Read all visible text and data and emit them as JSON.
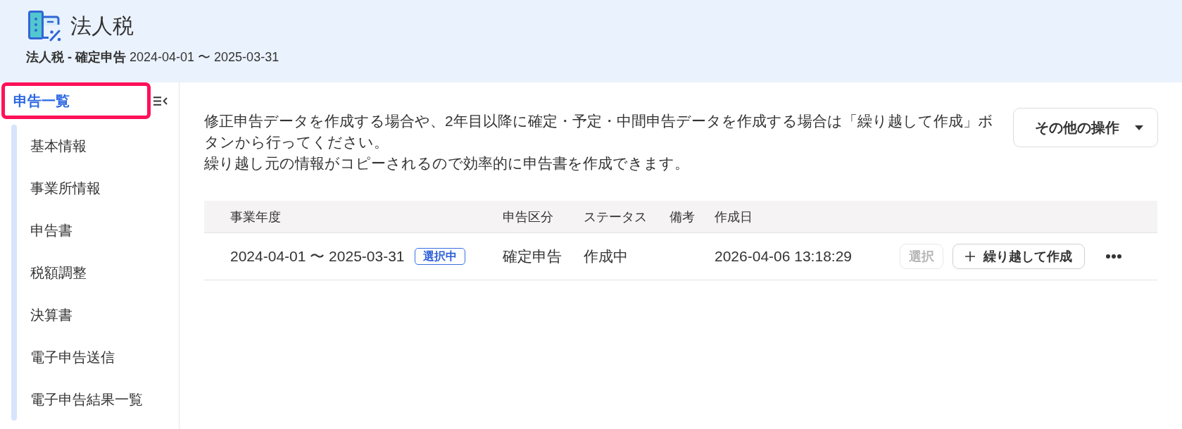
{
  "header": {
    "title": "法人税",
    "subtitle": "**法人税 - 確定申告** 2024-04-01 〜 2025-03-31"
  },
  "sidebar": {
    "items": [
      {
        "label": "申告一覧",
        "selected": true,
        "highlighted": true,
        "children": [
          {
            "label": "基本情報",
            "selected": false
          },
          {
            "label": "事業所情報",
            "selected": false
          },
          {
            "label": "申告書",
            "selected": false
          },
          {
            "label": "税額調整",
            "selected": false
          },
          {
            "label": "決算書",
            "selected": false
          },
          {
            "label": "電子申告送信",
            "selected": false
          },
          {
            "label": "電子申告結果一覧",
            "selected": false
          }
        ]
      }
    ]
  },
  "notice": [
    "修正申告データを作成する場合や、2年目以降に確定・予定・中間申告データを作成する場合は「繰り越して作成」ボタンから行ってください。",
    "繰り越し元の情報がコピーされるので効率的に申告書を作成できます。"
  ],
  "other_actions_button": {
    "label": "その他の操作"
  },
  "table": {
    "columns": [
      "事業年度",
      "申告区分",
      "ステータス",
      "備考",
      "作成日"
    ],
    "rows": [
      {
        "period": "2024-04-01 〜 2025-03-31",
        "badge": "選択中",
        "filing_type": "確定申告",
        "status": "作成中",
        "created_at": "2026-04-06 13:18:29",
        "actions": [
          {
            "kind": "select",
            "label": "選択",
            "disabled": true
          },
          {
            "kind": "carry_over",
            "label": "繰り越して作成",
            "disabled": false
          },
          {
            "kind": "more"
          }
        ]
      }
    ]
  }
}
